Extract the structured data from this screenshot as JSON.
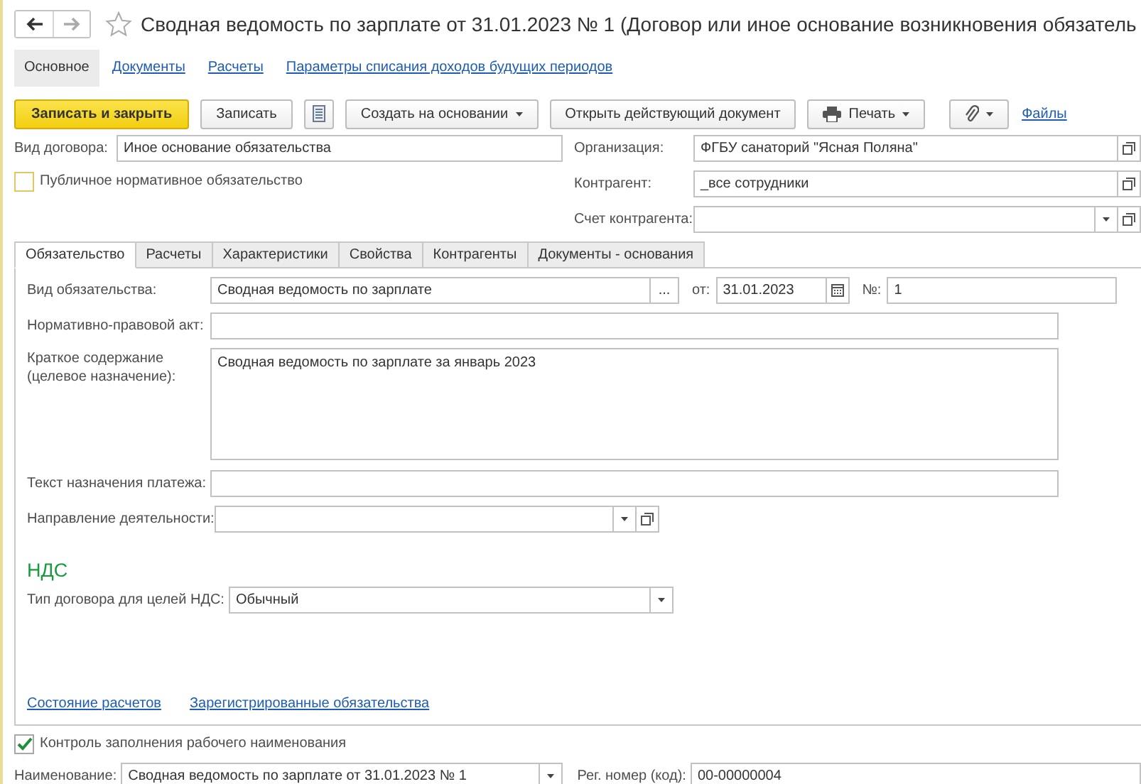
{
  "window": {
    "title": "Сводная ведомость по зарплате от 31.01.2023 № 1 (Договор или иное основание возникновения обязатель",
    "starred": false
  },
  "nav_buttons": [
    {
      "kind": "back",
      "disabled": false
    },
    {
      "kind": "forward",
      "disabled": true
    }
  ],
  "sections": [
    {
      "label": "Основное",
      "selected": true
    },
    {
      "label": "Документы",
      "selected": false
    },
    {
      "label": "Расчеты",
      "selected": false
    },
    {
      "label": "Параметры списания доходов будущих периодов",
      "selected": false
    }
  ],
  "toolbar": [
    {
      "kind": "primary",
      "label": "Записать и закрыть"
    },
    {
      "kind": "button",
      "label": "Записать"
    },
    {
      "kind": "list-icon"
    },
    {
      "kind": "menu",
      "label": "Создать на основании"
    },
    {
      "kind": "button",
      "label": "Открыть действующий документ"
    },
    {
      "kind": "print-menu",
      "label": "Печать"
    },
    {
      "kind": "attach-menu"
    },
    {
      "kind": "link",
      "label": "Файлы"
    }
  ],
  "contract_type": {
    "label": "Вид договора:",
    "value": "Иное основание обязательства"
  },
  "public_obligation": {
    "label": "Публичное нормативное обязательство",
    "checked": false
  },
  "organization": {
    "label": "Организация:",
    "value": "ФГБУ санаторий \"Ясная Поляна\""
  },
  "counterparty": {
    "label": "Контрагент:",
    "value": "_все сотрудники"
  },
  "counterparty_account": {
    "label": "Счет контрагента:"
  },
  "tabs": [
    {
      "label": "Обязательство",
      "selected": true
    },
    {
      "label": "Расчеты",
      "selected": false
    },
    {
      "label": "Характеристики",
      "selected": false
    },
    {
      "label": "Свойства",
      "selected": false
    },
    {
      "label": "Контрагенты",
      "selected": false
    },
    {
      "label": "Документы - основания",
      "selected": false
    }
  ],
  "obligation": {
    "type": {
      "label": "Вид обязательства:",
      "value": "Сводная ведомость по зарплате",
      "choice_button": "..."
    },
    "date": {
      "label": "от:",
      "value": "31.01.2023"
    },
    "number": {
      "label": "№:",
      "value": "1"
    },
    "legal_act": {
      "label": "Нормативно-правовой акт:"
    },
    "summary": {
      "label": "Краткое содержание (целевое назначение):",
      "value": "Сводная ведомость по зарплате за январь 2023"
    },
    "payment_purpose": {
      "label": "Текст назначения платежа:"
    },
    "activity": {
      "label": "Направление деятельности:"
    }
  },
  "vat": {
    "heading": "НДС",
    "contract_type": {
      "label": "Тип договора для целей НДС:",
      "value": "Обычный"
    }
  },
  "links": [
    "Состояние расчетов",
    "Зарегистрированные обязательства"
  ],
  "name_control": {
    "label": "Контроль заполнения рабочего наименования",
    "checked": true
  },
  "name": {
    "label": "Наименование:",
    "value": "Сводная ведомость по зарплате от 31.01.2023 № 1"
  },
  "reg_number": {
    "label": "Рег. номер (код):",
    "value": "00-00000004"
  }
}
